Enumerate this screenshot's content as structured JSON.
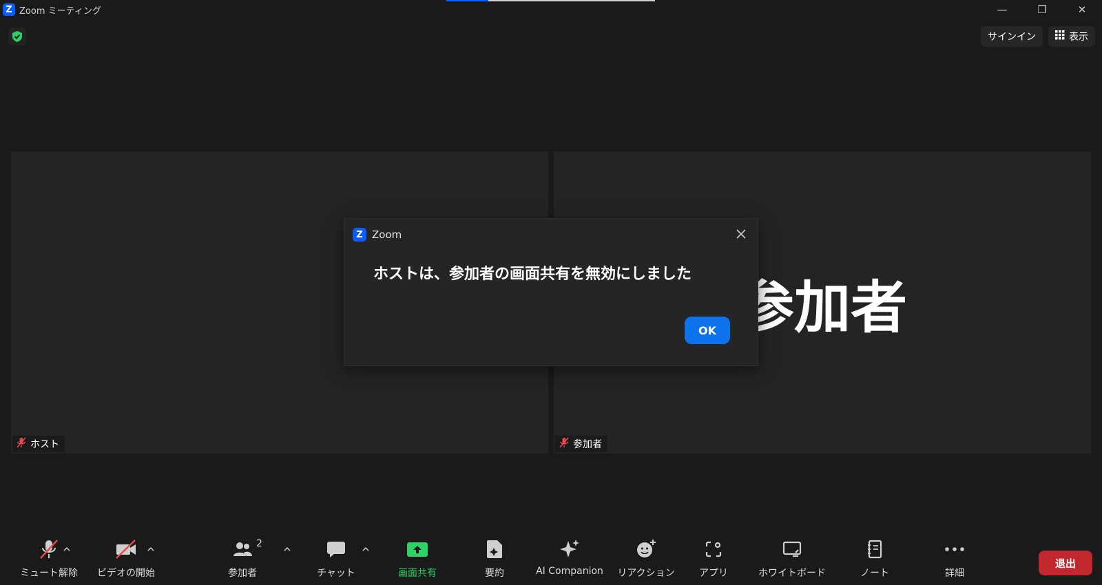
{
  "window": {
    "logo_letter": "Z",
    "title": "Zoom ミーティング",
    "minimize_glyph": "—",
    "restore_glyph": "❐",
    "close_glyph": "✕"
  },
  "top_actions": {
    "sign_in": "サインイン",
    "view": "表示"
  },
  "tiles": [
    {
      "name": "ホスト",
      "muted": true
    },
    {
      "name": "参加者",
      "muted": true,
      "big_name": "参加者"
    }
  ],
  "dialog": {
    "logo_letter": "Z",
    "title": "Zoom",
    "message": "ホストは、参加者の画面共有を無効にしました",
    "ok_label": "OK"
  },
  "toolbar": {
    "unmute": "ミュート解除",
    "start_video": "ビデオの開始",
    "participants": "参加者",
    "participant_count": "2",
    "chat": "チャット",
    "share_screen": "画面共有",
    "summary": "要約",
    "ai_companion": "AI Companion",
    "reactions": "リアクション",
    "apps": "アプリ",
    "whiteboard": "ホワイトボード",
    "notes": "ノート",
    "more": "詳細",
    "leave": "退出"
  },
  "colors": {
    "accent_blue": "#0e72ed",
    "share_green": "#2ed164",
    "leave_red": "#c2272d",
    "muted_red": "#e5484d"
  }
}
